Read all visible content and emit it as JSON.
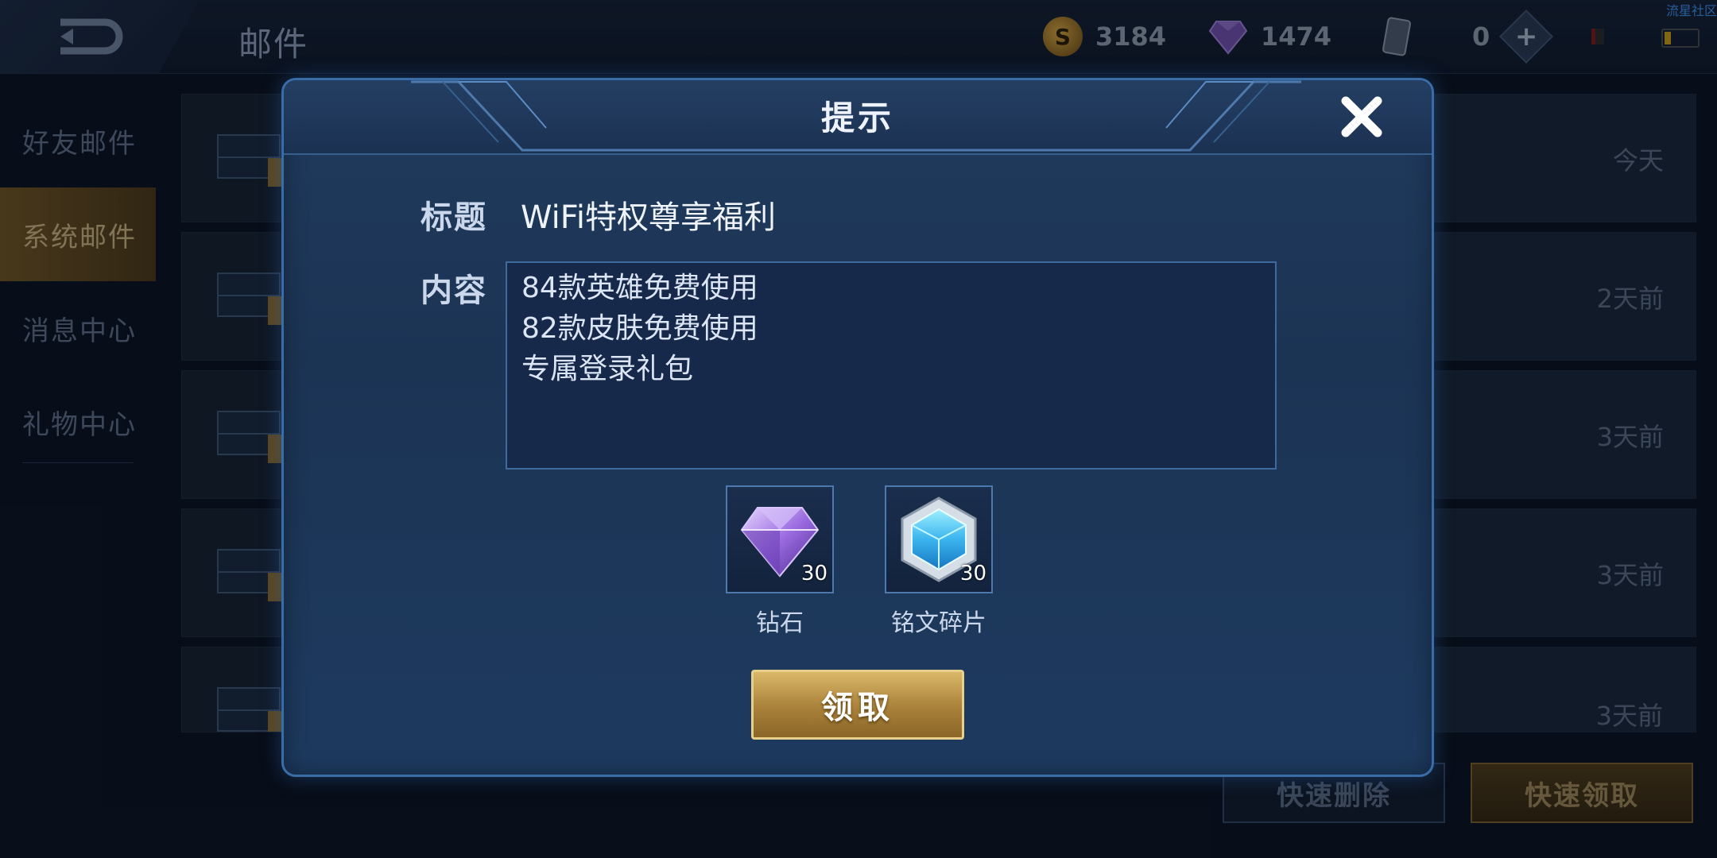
{
  "corner_label": "流星社区",
  "topbar": {
    "page_title": "邮件",
    "gold": "3184",
    "diamonds": "1474",
    "cards": "0"
  },
  "sidebar": {
    "items": [
      {
        "label": "好友邮件"
      },
      {
        "label": "系统邮件"
      },
      {
        "label": "消息中心"
      },
      {
        "label": "礼物中心"
      }
    ]
  },
  "mail_list": {
    "rows": [
      {
        "time": "今天"
      },
      {
        "time": "2天前"
      },
      {
        "time": "3天前"
      },
      {
        "time": "3天前"
      },
      {
        "time": "3天前"
      }
    ]
  },
  "bottom": {
    "delete_label": "快速删除",
    "claim_all_label": "快速领取"
  },
  "dialog": {
    "title": "提示",
    "subject_label": "标题",
    "subject_value": "WiFi特权尊享福利",
    "content_label": "内容",
    "content_lines": [
      "84款英雄免费使用",
      "82款皮肤免费使用",
      "专属登录礼包"
    ],
    "rewards": [
      {
        "name": "钻石",
        "qty": "30",
        "icon": "diamond-icon"
      },
      {
        "name": "铭文碎片",
        "qty": "30",
        "icon": "inscription-shard-icon"
      }
    ],
    "claim_label": "领取"
  },
  "colors": {
    "accent_blue": "#3a6ca8",
    "gold_button": "#c9a157",
    "background": "#0b1320"
  }
}
